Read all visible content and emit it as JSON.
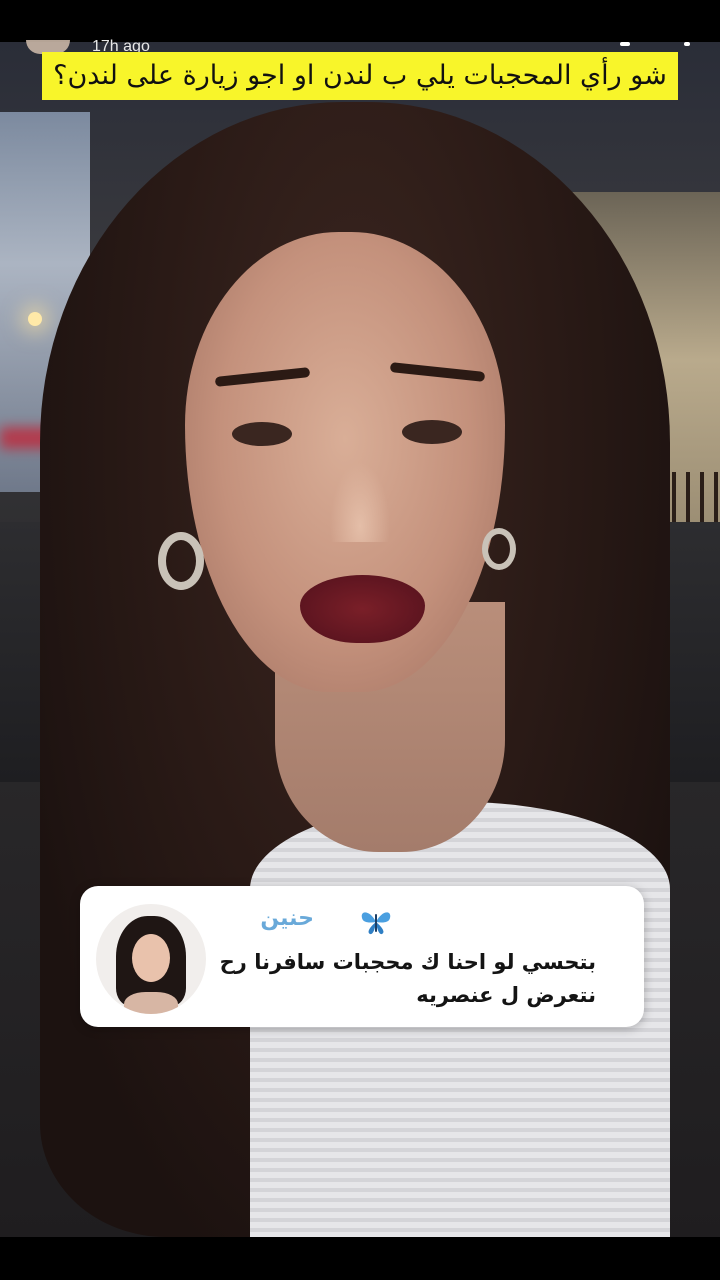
{
  "header": {
    "timestamp": "17h ago",
    "caption": "شو رأي المحجبات يلي ب لندن او اجو زيارة على لندن؟"
  },
  "question_sticker": {
    "username": "حنين",
    "question": "بتحسي لو احنا ك محجبات سافرنا رح نتعرض ل عنصريه",
    "avatar_icon": "bitmoji-avatar",
    "username_icon": "butterfly-icon"
  },
  "colors": {
    "caption_bg": "#f8f52a",
    "username": "#69a9d9",
    "sticker_bg": "#ffffff"
  }
}
